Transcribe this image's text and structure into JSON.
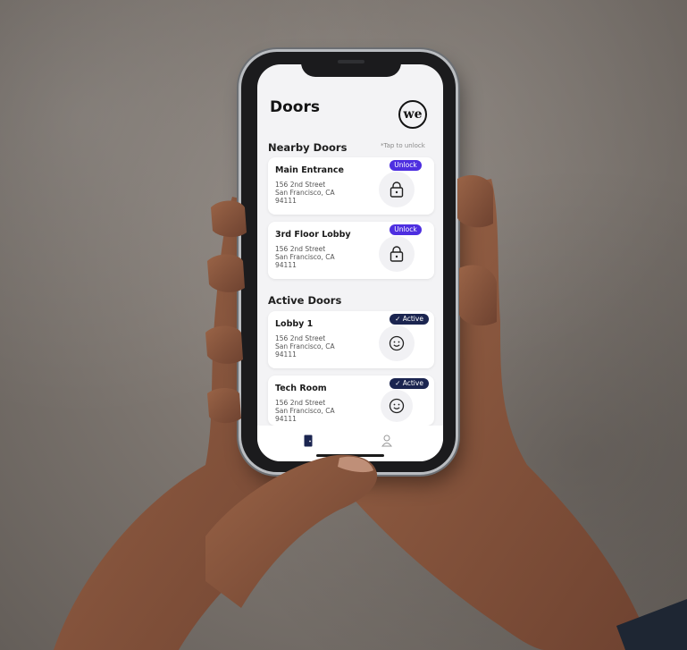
{
  "app": {
    "title": "Doors",
    "logo_text": "we"
  },
  "nearby": {
    "heading": "Nearby Doors",
    "hint": "*Tap to unlock",
    "doors": [
      {
        "name": "Main Entrance",
        "addr1": "156 2nd Street",
        "addr2": "San Francisco, CA",
        "addr3": "94111",
        "badge": "Unlock",
        "icon": "lock-icon"
      },
      {
        "name": "3rd Floor Lobby",
        "addr1": "156 2nd Street",
        "addr2": "San Francisco, CA",
        "addr3": "94111",
        "badge": "Unlock",
        "icon": "lock-icon"
      }
    ]
  },
  "active": {
    "heading": "Active Doors",
    "doors": [
      {
        "name": "Lobby 1",
        "addr1": "156 2nd Street",
        "addr2": "San Francisco, CA",
        "addr3": "94111",
        "badge": "✓ Active",
        "icon": "smiley-icon"
      },
      {
        "name": "Tech Room",
        "addr1": "156 2nd Street",
        "addr2": "San Francisco, CA",
        "addr3": "94111",
        "badge": "✓ Active",
        "icon": "smiley-icon"
      }
    ]
  },
  "tabbar": {
    "items": [
      "door-icon",
      "profile-icon"
    ],
    "selected": 0
  },
  "colors": {
    "unlock": "#4d2ee0",
    "active": "#1b2550",
    "screen_bg": "#f3f3f5"
  }
}
